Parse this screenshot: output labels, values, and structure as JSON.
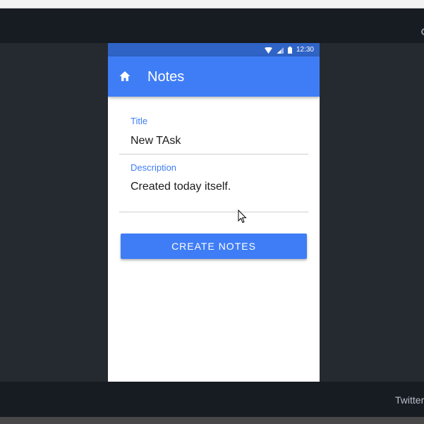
{
  "status_bar": {
    "time": "12:30",
    "icons": [
      "wifi-icon",
      "cellular-signal-icon",
      "battery-icon"
    ]
  },
  "app_bar": {
    "title": "Notes",
    "nav_icon": "home-icon"
  },
  "form": {
    "title_field": {
      "label": "Title",
      "value": "New TAsk"
    },
    "description_field": {
      "label": "Description",
      "value": "Created today itself."
    },
    "submit_label": "CREATE NOTES"
  },
  "footer": {
    "link_text": "Twitter"
  },
  "colors": {
    "primary": "#3f7df6",
    "status_bar": "#2f63c5",
    "page_bg": "#252a31",
    "header_bg": "#171b22"
  }
}
